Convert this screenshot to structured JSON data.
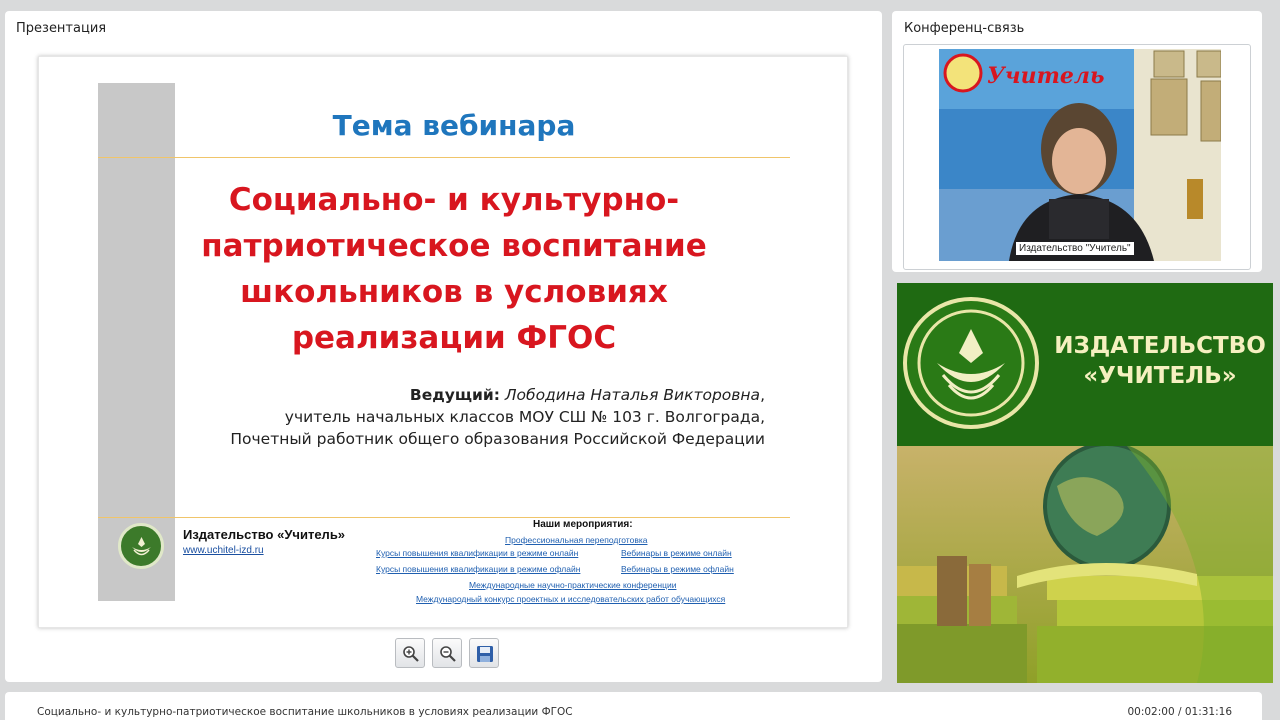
{
  "presentation": {
    "title": "Презентация",
    "slide": {
      "heading": "Тема вебинара",
      "main_title": "Социально- и культурно-патриотическое воспитание школьников в условиях реализации ФГОС",
      "presenter_label": "Ведущий:",
      "presenter_name": "Лободина Наталья Викторовна",
      "presenter_name_suffix": ",",
      "presenter_line2": "учитель начальных классов МОУ СШ № 103 г. Волгограда,",
      "presenter_line3": "Почетный работник общего образования Российской Федерации",
      "publisher": "Издательство «Учитель»",
      "site": "www.uchitel-izd.ru",
      "events_heading": "Наши мероприятия:",
      "events": [
        "Профессиональная переподготовка",
        "Курсы повышения квалификации в режиме онлайн",
        "Вебинары в режиме онлайн",
        "Курсы повышения квалификации в режиме офлайн",
        "Вебинары в режиме офлайн",
        "Международные научно-практические конференции",
        "Международный конкурс проектных и исследовательских работ обучающихся"
      ]
    },
    "controls": [
      {
        "icon": "zoom-in-icon"
      },
      {
        "icon": "zoom-out-icon"
      },
      {
        "icon": "save-icon"
      }
    ]
  },
  "conference": {
    "title": "Конференц-связь",
    "video_label": "Издательство \"Учитель\"",
    "backdrop_text": "Учитель"
  },
  "banner": {
    "line1": "ИЗДАТЕЛЬСТВО",
    "line2": "«УЧИТЕЛЬ»"
  },
  "status": {
    "title": "Социально- и культурно-патриотическое воспитание школьников в условиях реализации ФГОС",
    "time": "00:02:00 / 01:31:16"
  },
  "colors": {
    "accent_blue": "#1f76bd",
    "title_red": "#d8161f",
    "brand_green": "#1f6a12"
  }
}
